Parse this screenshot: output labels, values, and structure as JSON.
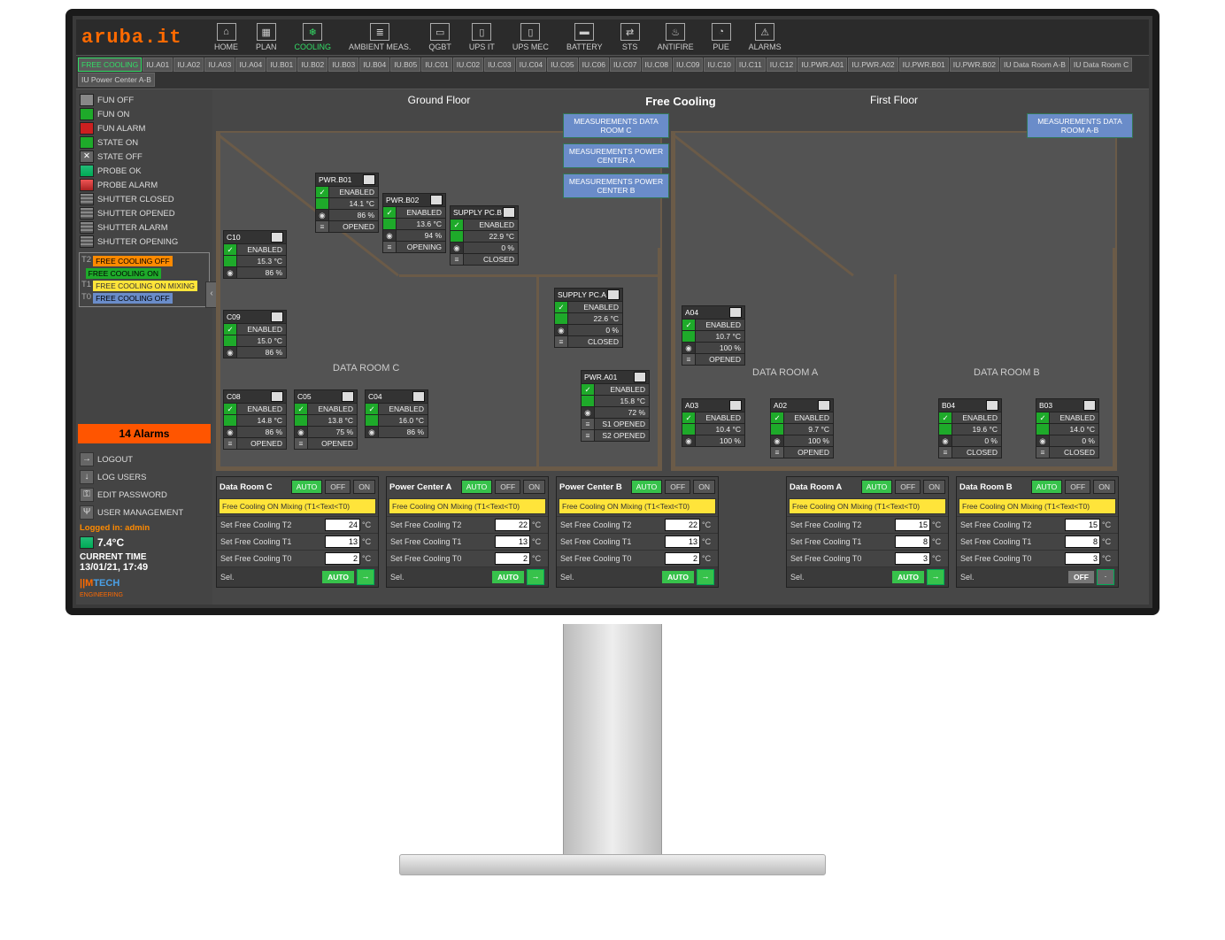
{
  "brand": "aruba.it",
  "nav": [
    "HOME",
    "PLAN",
    "COOLING",
    "AMBIENT MEAS.",
    "QGBT",
    "UPS IT",
    "UPS MEC",
    "BATTERY",
    "STS",
    "ANTIFIRE",
    "PUE",
    "ALARMS"
  ],
  "nav_active": "COOLING",
  "tabs": [
    "FREE COOLING",
    "IU.A01",
    "IU.A02",
    "IU.A03",
    "IU.A04",
    "IU.B01",
    "IU.B02",
    "IU.B03",
    "IU.B04",
    "IU.B05",
    "IU.C01",
    "IU.C02",
    "IU.C03",
    "IU.C04",
    "IU.C05",
    "IU.C06",
    "IU.C07",
    "IU.C08",
    "IU.C09",
    "IU.C10",
    "IU.C11",
    "IU.C12",
    "IU.PWR.A01",
    "IU.PWR.A02",
    "IU.PWR.B01",
    "IU.PWR.B02",
    "IU Data Room A-B",
    "IU Data Room C",
    "IU Power Center A-B"
  ],
  "tabs_active": "FREE COOLING",
  "page_title": "Free Cooling",
  "legend": {
    "fun_off": "FUN OFF",
    "fun_on": "FUN ON",
    "fun_alarm": "FUN ALARM",
    "state_on": "STATE ON",
    "state_off": "STATE OFF",
    "probe_ok": "PROBE OK",
    "probe_alarm": "PROBE ALARM",
    "shutter_closed": "SHUTTER CLOSED",
    "shutter_opened": "SHUTTER OPENED",
    "shutter_alarm": "SHUTTER ALARM",
    "shutter_opening": "SHUTTER OPENING"
  },
  "fc_legend": {
    "t2": "T2",
    "t1": "T1",
    "t0": "T0",
    "off": "FREE COOLING OFF",
    "on": "FREE COOLING ON",
    "mix": "FREE COOLING ON MIXING",
    "off2": "FREE COOLING OFF"
  },
  "alarms": {
    "count": "14 Alarms"
  },
  "user_menu": {
    "logout": "LOGOUT",
    "log_users": "LOG USERS",
    "edit_pw": "EDIT PASSWORD",
    "user_mgmt": "USER MANAGEMENT"
  },
  "session": {
    "logged": "Logged in: admin",
    "temp": "7.4°C",
    "clock_label": "CURRENT TIME",
    "clock": "13/01/21, 17:49"
  },
  "footer": {
    "mtech": "MTECH",
    "sub": "ENGINEERING"
  },
  "floors": {
    "ground": {
      "label": "Ground Floor",
      "room": "DATA ROOM C",
      "buttons": {
        "meas_c": "MEASUREMENTS DATA ROOM C",
        "meas_pa": "MEASUREMENTS POWER CENTER A",
        "meas_pb": "MEASUREMENTS POWER CENTER B"
      }
    },
    "first": {
      "label": "First Floor",
      "room_a": "DATA ROOM A",
      "room_b": "DATA ROOM B",
      "buttons": {
        "meas_ab": "MEASUREMENTS DATA ROOM A-B"
      }
    }
  },
  "units": {
    "c10": {
      "name": "C10",
      "enabled": "ENABLED",
      "temp": "15.3 °C",
      "pct": "86 %"
    },
    "c09": {
      "name": "C09",
      "enabled": "ENABLED",
      "temp": "15.0 °C",
      "pct": "86 %"
    },
    "c08": {
      "name": "C08",
      "enabled": "ENABLED",
      "temp": "14.8 °C",
      "pct": "86 %",
      "sh": "OPENED"
    },
    "c05": {
      "name": "C05",
      "enabled": "ENABLED",
      "temp": "13.8 °C",
      "pct": "75 %",
      "sh": "OPENED"
    },
    "c04": {
      "name": "C04",
      "enabled": "ENABLED",
      "temp": "16.0 °C",
      "pct": "86 %"
    },
    "pwrb01": {
      "name": "PWR.B01",
      "enabled": "ENABLED",
      "temp": "14.1 °C",
      "pct": "86 %",
      "sh": "OPENED"
    },
    "pwrb02": {
      "name": "PWR.B02",
      "enabled": "ENABLED",
      "temp": "13.6 °C",
      "pct": "94 %",
      "sh": "OPENING"
    },
    "supb": {
      "name": "SUPPLY PC.B",
      "enabled": "ENABLED",
      "temp": "22.9 °C",
      "pct": "0 %",
      "sh": "CLOSED"
    },
    "supa": {
      "name": "SUPPLY PC.A",
      "enabled": "ENABLED",
      "temp": "22.6 °C",
      "pct": "0 %",
      "sh": "CLOSED"
    },
    "pwra01": {
      "name": "PWR.A01",
      "enabled": "ENABLED",
      "temp": "15.8 °C",
      "pct": "72 %",
      "sh1": "S1 OPENED",
      "sh2": "S2 OPENED"
    },
    "a04": {
      "name": "A04",
      "enabled": "ENABLED",
      "temp": "10.7 °C",
      "pct": "100 %",
      "sh": "OPENED"
    },
    "a03": {
      "name": "A03",
      "enabled": "ENABLED",
      "temp": "10.4 °C",
      "pct": "100 %"
    },
    "a02": {
      "name": "A02",
      "enabled": "ENABLED",
      "temp": "9.7 °C",
      "pct": "100 %",
      "sh": "OPENED"
    },
    "b04": {
      "name": "B04",
      "enabled": "ENABLED",
      "temp": "19.6 °C",
      "pct": "0 %",
      "sh": "CLOSED"
    },
    "b03": {
      "name": "B03",
      "enabled": "ENABLED",
      "temp": "14.0 °C",
      "pct": "0 %",
      "sh": "CLOSED"
    }
  },
  "panels": {
    "labels": {
      "t2": "Set Free Cooling T2",
      "t1": "Set Free Cooling T1",
      "t0": "Set Free Cooling T0",
      "sel": "Sel.",
      "auto": "AUTO",
      "off": "OFF",
      "on": "ON",
      "deg": "°C"
    },
    "banner": "Free Cooling ON Mixing (T1<Text<T0)",
    "drc": {
      "title": "Data Room C",
      "t2": "24",
      "t1": "13",
      "t0": "2",
      "sel": "AUTO"
    },
    "pca": {
      "title": "Power Center A",
      "t2": "22",
      "t1": "13",
      "t0": "2",
      "sel": "AUTO"
    },
    "pcb": {
      "title": "Power Center B",
      "t2": "22",
      "t1": "13",
      "t0": "2",
      "sel": "AUTO"
    },
    "dra": {
      "title": "Data Room A",
      "t2": "15",
      "t1": "8",
      "t0": "3",
      "sel": "AUTO"
    },
    "drb": {
      "title": "Data Room B",
      "t2": "15",
      "t1": "8",
      "t0": "3",
      "sel": "OFF"
    }
  }
}
